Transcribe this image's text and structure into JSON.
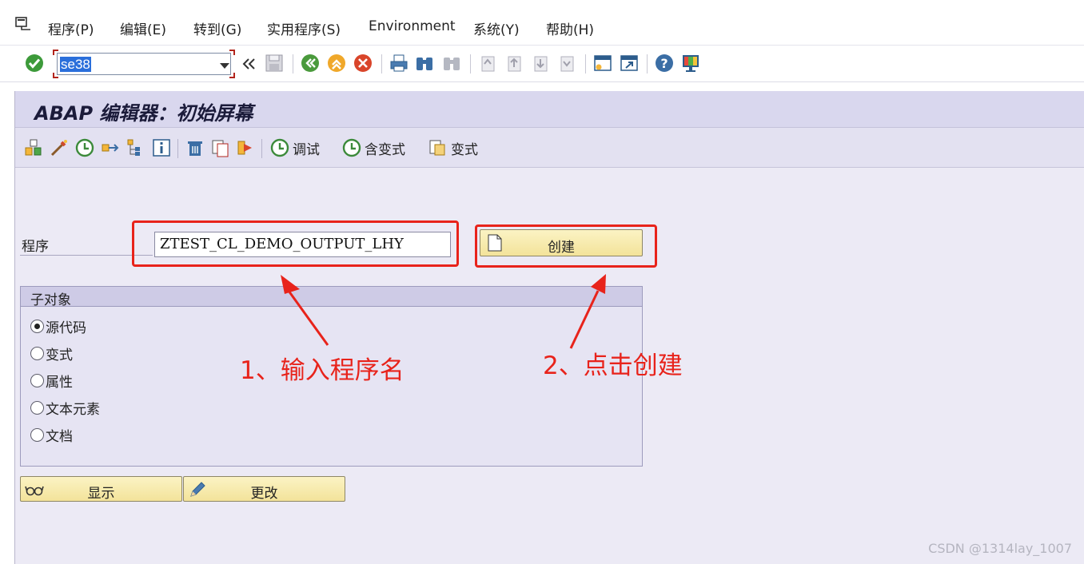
{
  "menu": {
    "items": [
      "程序(P)",
      "编辑(E)",
      "转到(G)",
      "实用程序(S)",
      "Environment",
      "系统(Y)",
      "帮助(H)"
    ]
  },
  "system_toolbar": {
    "command_value": "se38",
    "icons": [
      "enter-icon",
      "history-icon",
      "save-icon",
      "back-icon",
      "exit-icon",
      "cancel-icon",
      "print-icon",
      "find-icon",
      "find-next-icon",
      "first-page-icon",
      "previous-page-icon",
      "next-page-icon",
      "last-page-icon",
      "new-session-icon",
      "shortcut-icon",
      "help-icon",
      "customize-layout-icon"
    ]
  },
  "screen": {
    "title": "ABAP 编辑器：初始屏幕"
  },
  "app_toolbar": {
    "debug_label": "调试",
    "with_variant_label": "含变式",
    "variants_label": "变式"
  },
  "program": {
    "label": "程序",
    "value": "ZTEST_CL_DEMO_OUTPUT_LHY",
    "create_label": "创建"
  },
  "subobjects": {
    "title": "子对象",
    "options": [
      {
        "label": "源代码",
        "selected": true
      },
      {
        "label": "变式",
        "selected": false
      },
      {
        "label": "属性",
        "selected": false
      },
      {
        "label": "文本元素",
        "selected": false
      },
      {
        "label": "文档",
        "selected": false
      }
    ]
  },
  "actions": {
    "display_label": "显示",
    "change_label": "更改"
  },
  "annotations": {
    "step1": "1、输入程序名",
    "step2": "2、点击创建",
    "color": "#e8231b"
  },
  "watermark": "CSDN @1314lay_1007"
}
